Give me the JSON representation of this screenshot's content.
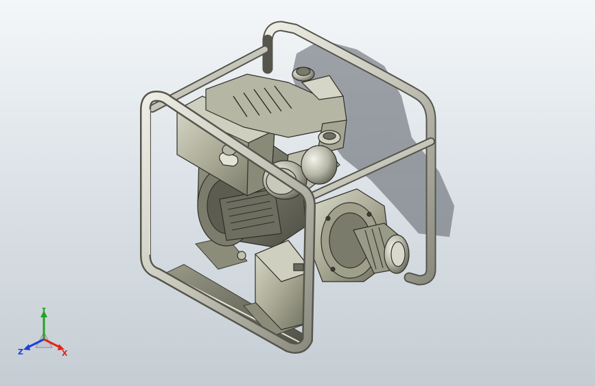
{
  "viewport": {
    "background_top": "#f4f7f9",
    "background_bottom": "#c5cdd4"
  },
  "model": {
    "frame_color": "#c8c8bc",
    "body_color": "#a9a995",
    "shadow_color": "#6f737a"
  },
  "triad": {
    "x_label": "X",
    "y_label": "Y",
    "z_label": "Z",
    "x_color": "#e2231a",
    "y_color": "#1ea51e",
    "z_color": "#1d3fd6"
  }
}
